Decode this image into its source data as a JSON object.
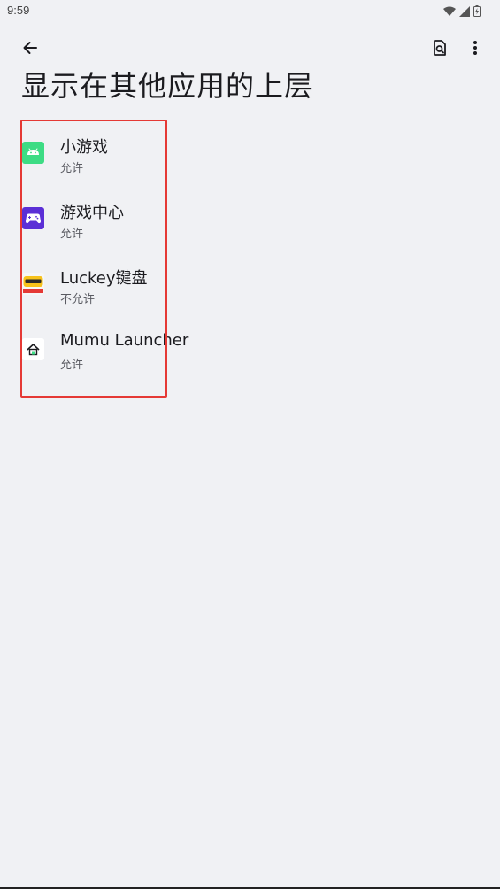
{
  "status_bar": {
    "time": "9:59"
  },
  "page": {
    "title": "显示在其他应用的上层"
  },
  "apps": [
    {
      "name": "小游戏",
      "status": "允许",
      "icon": "android-icon"
    },
    {
      "name": "游戏中心",
      "status": "允许",
      "icon": "gamepad-icon"
    },
    {
      "name": "Luckey键盘",
      "status": "不允许",
      "icon": "luckey-keyboard-icon"
    },
    {
      "name": "Mumu Launcher",
      "status": "允许",
      "icon": "home-launcher-icon"
    }
  ],
  "colors": {
    "background": "#f0f1f4",
    "highlight": "#e53935",
    "android_green": "#3ddc84",
    "game_purple": "#5b2fd6"
  }
}
